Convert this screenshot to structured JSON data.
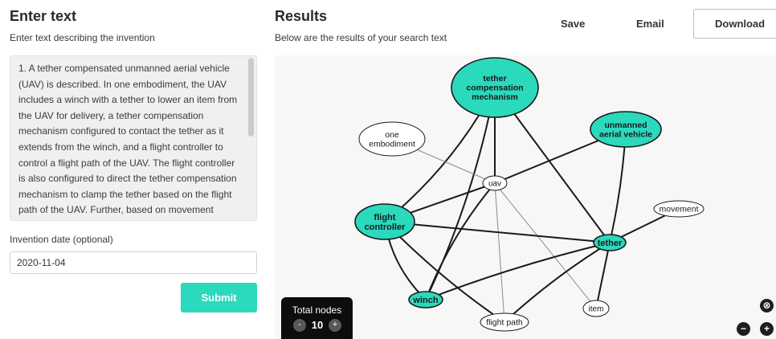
{
  "left": {
    "title": "Enter text",
    "subtitle": "Enter text describing the invention",
    "invention_text": "1. A tether compensated unmanned aerial vehicle (UAV) is described. In one embodiment, the UAV includes a winch with a tether to lower an item from the UAV for delivery, a tether compensation mechanism configured to contact the tether as it extends from the winch, and a flight controller to control a flight path of the UAV. The flight controller is also configured to direct the tether compensation mechanism to clamp the tether based on the flight path of the UAV. Further, based on movement identified in the tether using a sensor, a tether",
    "date_label": "Invention date (optional)",
    "date_value": "2020-11-04",
    "submit_label": "Submit"
  },
  "right": {
    "title": "Results",
    "subtitle": "Below are the results of your search text",
    "save_label": "Save",
    "email_label": "Email",
    "download_label": "Download"
  },
  "controls": {
    "total_nodes_label": "Total nodes",
    "total_nodes": "10",
    "minus": "-",
    "plus": "+",
    "zoom_reset": "⊗",
    "zoom_out": "−",
    "zoom_in": "+"
  },
  "graph": {
    "colors": {
      "primary": "#2bd9bd",
      "secondary": "#ffffff",
      "strong_edge": "#1a1a1a",
      "weak_edge": "#8a8a8a"
    },
    "nodes": [
      {
        "id": "tcm",
        "label": [
          "tether",
          "compensation",
          "mechanism"
        ],
        "primary": true
      },
      {
        "id": "uav_full",
        "label": [
          "unmanned",
          "aerial vehicle"
        ],
        "primary": true
      },
      {
        "id": "one_emb",
        "label": [
          "one",
          "embodiment"
        ],
        "primary": false
      },
      {
        "id": "uav",
        "label": [
          "uav"
        ],
        "primary": false
      },
      {
        "id": "fc",
        "label": [
          "flight",
          "controller"
        ],
        "primary": true
      },
      {
        "id": "movement",
        "label": [
          "movement"
        ],
        "primary": false
      },
      {
        "id": "tether",
        "label": [
          "tether"
        ],
        "primary": true
      },
      {
        "id": "winch",
        "label": [
          "winch"
        ],
        "primary": true
      },
      {
        "id": "item",
        "label": [
          "item"
        ],
        "primary": false
      },
      {
        "id": "fp",
        "label": [
          "flight path"
        ],
        "primary": false
      }
    ],
    "edges": [
      {
        "from": "tcm",
        "to": "fc",
        "strong": true
      },
      {
        "from": "tcm",
        "to": "winch",
        "strong": true
      },
      {
        "from": "tcm",
        "to": "tether",
        "strong": true
      },
      {
        "from": "tcm",
        "to": "uav",
        "strong": true
      },
      {
        "from": "uav_full",
        "to": "tether",
        "strong": true
      },
      {
        "from": "uav_full",
        "to": "uav",
        "strong": true
      },
      {
        "from": "one_emb",
        "to": "uav",
        "strong": false
      },
      {
        "from": "uav",
        "to": "fc",
        "strong": true
      },
      {
        "from": "uav",
        "to": "winch",
        "strong": true
      },
      {
        "from": "uav",
        "to": "fp",
        "strong": false
      },
      {
        "from": "uav",
        "to": "item",
        "strong": false
      },
      {
        "from": "fc",
        "to": "winch",
        "strong": true
      },
      {
        "from": "fc",
        "to": "fp",
        "strong": true
      },
      {
        "from": "fc",
        "to": "tether",
        "strong": true
      },
      {
        "from": "winch",
        "to": "tether",
        "strong": true
      },
      {
        "from": "movement",
        "to": "tether",
        "strong": true
      },
      {
        "from": "tether",
        "to": "item",
        "strong": true
      },
      {
        "from": "tether",
        "to": "fp",
        "strong": true
      }
    ]
  }
}
